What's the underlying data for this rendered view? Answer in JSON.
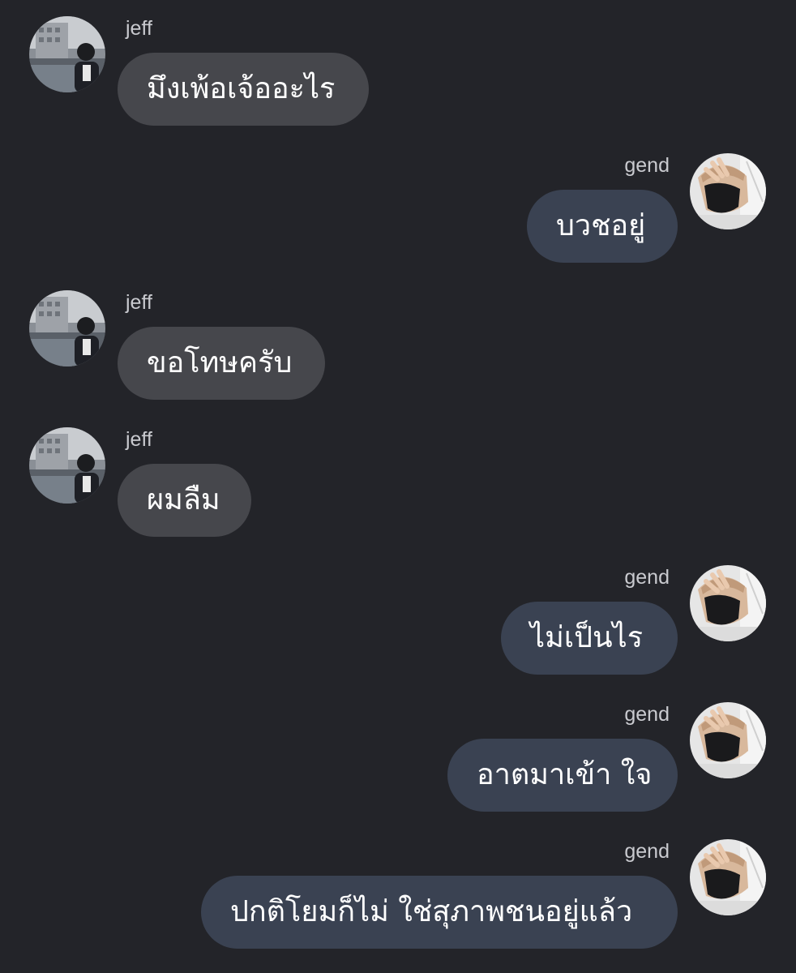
{
  "colors": {
    "background": "#232429",
    "incoming_bubble": "#46474c",
    "outgoing_bubble": "#3a4252",
    "name_text": "#c9cacf",
    "message_text": "#ffffff"
  },
  "messages": [
    {
      "sender": "jeff",
      "side": "incoming",
      "text": "มึงเพ้อเจ้ออะไร",
      "avatar_icon": "jeff-avatar-photo"
    },
    {
      "sender": "gend",
      "side": "outgoing",
      "text": "บวชอยู่",
      "avatar_icon": "gend-avatar-photo"
    },
    {
      "sender": "jeff",
      "side": "incoming",
      "text": "ขอโทษครับ",
      "avatar_icon": "jeff-avatar-photo"
    },
    {
      "sender": "jeff",
      "side": "incoming",
      "text": "ผมลืม",
      "avatar_icon": "jeff-avatar-photo"
    },
    {
      "sender": "gend",
      "side": "outgoing",
      "text": "ไม่เป็นไร",
      "avatar_icon": "gend-avatar-photo"
    },
    {
      "sender": "gend",
      "side": "outgoing",
      "text": "อาตมาเข้า ใจ",
      "avatar_icon": "gend-avatar-photo"
    },
    {
      "sender": "gend",
      "side": "outgoing",
      "text": "ปกติโยมก็ไม่ ใช่สุภาพชนอยู่แล้ว",
      "avatar_icon": "gend-avatar-photo"
    }
  ]
}
